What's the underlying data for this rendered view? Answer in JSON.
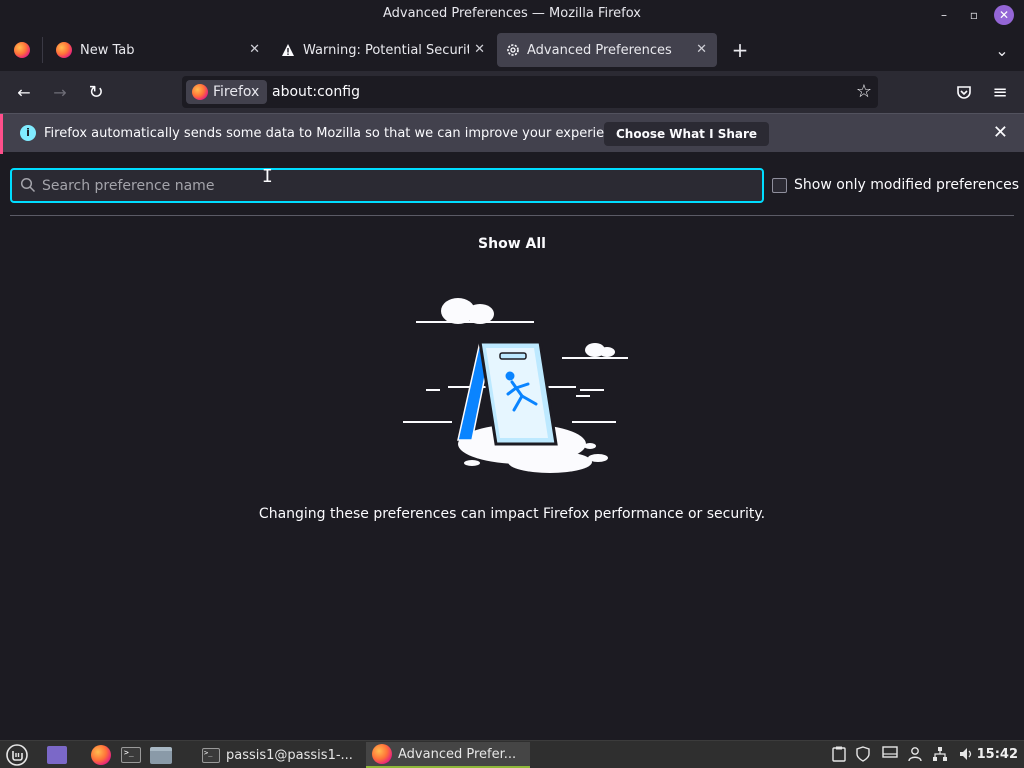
{
  "window": {
    "title": "Advanced Preferences — Mozilla Firefox",
    "minimize_glyph": "–",
    "maximize_glyph": "▫",
    "close_glyph": "✕"
  },
  "tabs": [
    {
      "label": "New Tab",
      "icon": "firefox-icon"
    },
    {
      "label": "Warning: Potential Security",
      "icon": "warning-icon"
    },
    {
      "label": "Advanced Preferences",
      "icon": "gear-icon",
      "active": true
    }
  ],
  "tabbar": {
    "new_tab_glyph": "+",
    "list_all_glyph": "⌄",
    "close_glyph": "✕"
  },
  "navbar": {
    "identity_label": "Firefox",
    "url": "about:config",
    "back_glyph": "←",
    "forward_glyph": "→",
    "reload_glyph": "↻",
    "bookmark_glyph": "☆",
    "menu_glyph": "≡"
  },
  "notification": {
    "icon_glyph": "i",
    "text": "Firefox automatically sends some data to Mozilla so that we can improve your experience.",
    "button_label": "Choose What I Share",
    "close_glyph": "✕"
  },
  "config": {
    "search_placeholder": "Search preference name",
    "modified_only_label": "Show only modified preferences",
    "show_all_label": "Show All",
    "warning_text": "Changing these preferences can impact Firefox performance or security."
  },
  "taskbar": {
    "tasks": [
      {
        "label": "passis1@passis1-...",
        "icon": "terminal-icon"
      },
      {
        "label": "Advanced Prefer...",
        "icon": "firefox-icon",
        "active": true
      }
    ],
    "clock": "15:42"
  },
  "colors": {
    "accent": "#00ddff",
    "notification_accent": "#ff4f8b",
    "background": "#1c1b22",
    "toolbar": "#2b2a33"
  }
}
